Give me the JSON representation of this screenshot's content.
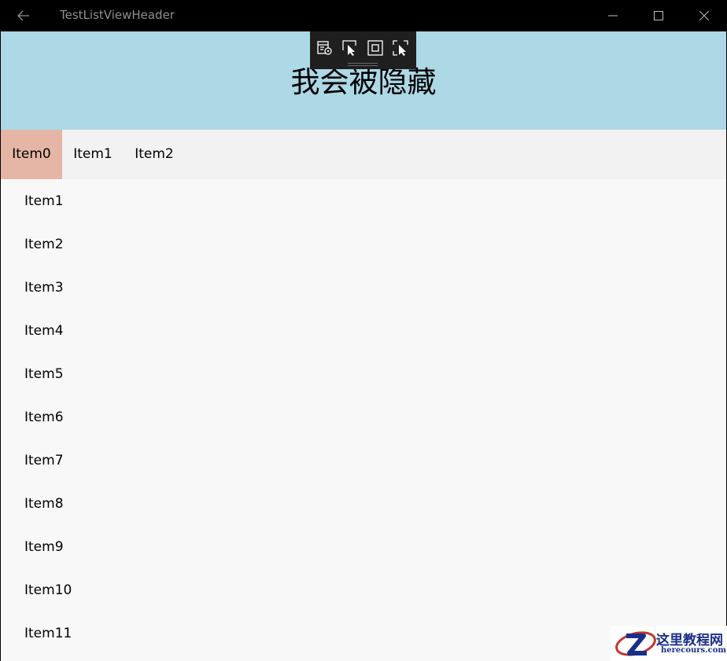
{
  "titlebar": {
    "back_icon": "arrow-left-icon",
    "title": "TestListViewHeader",
    "minimize_icon": "minimize-icon",
    "maximize_icon": "maximize-icon",
    "close_icon": "close-icon"
  },
  "debug_toolbar": {
    "tools": [
      {
        "icon": "live-visual-tree-icon"
      },
      {
        "icon": "select-element-icon"
      },
      {
        "icon": "display-layout-adorners-icon"
      },
      {
        "icon": "track-focus-icon"
      }
    ]
  },
  "header": {
    "text": "我会被隐藏",
    "background": "#add8e6"
  },
  "horizontal_bar": {
    "items": [
      {
        "label": "Item0",
        "selected": true
      },
      {
        "label": "Item1",
        "selected": false
      },
      {
        "label": "Item2",
        "selected": false
      }
    ],
    "selected_color": "#e5b6a6"
  },
  "list": {
    "items": [
      "Item1",
      "Item2",
      "Item3",
      "Item4",
      "Item5",
      "Item6",
      "Item7",
      "Item8",
      "Item9",
      "Item10",
      "Item11"
    ]
  },
  "watermark": {
    "title": "这里教程网",
    "url": "herecours.com"
  }
}
